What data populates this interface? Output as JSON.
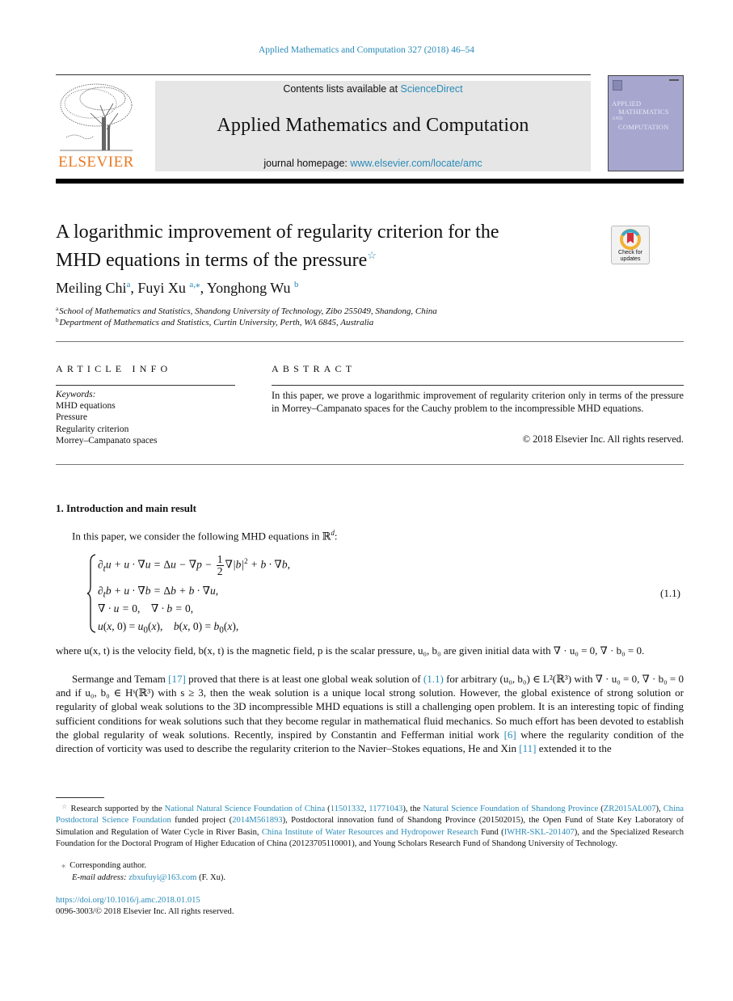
{
  "running_head": "Applied Mathematics and Computation 327 (2018) 46–54",
  "masthead": {
    "publisher_wordmark": "ELSEVIER",
    "contents_prefix": "Contents lists available at ",
    "contents_link": "ScienceDirect",
    "journal_title": "Applied Mathematics and Computation",
    "homepage_prefix": "journal homepage: ",
    "homepage_link": "www.elsevier.com/locate/amc",
    "cover": {
      "line1": "APPLIED",
      "line2": "MATHEMATICS",
      "line3": "AND",
      "line4": "COMPUTATION",
      "color": "#a6a6cf"
    }
  },
  "article": {
    "title_line1": "A logarithmic improvement of regularity criterion for the",
    "title_line2": "MHD equations in terms of the pressure",
    "title_mark": "☆",
    "check_updates": {
      "line1": "Check for",
      "line2": "updates"
    },
    "authors": [
      {
        "name": "Meiling Chi",
        "sup": "a"
      },
      {
        "name": "Fuyi Xu",
        "sup": "a,⁎"
      },
      {
        "name": "Yonghong Wu",
        "sup": "b"
      }
    ],
    "affiliations": [
      {
        "mark": "a",
        "text": "School of Mathematics and Statistics, Shandong University of Technology, Zibo 255049, Shandong, China"
      },
      {
        "mark": "b",
        "text": "Department of Mathematics and Statistics, Curtin University, Perth, WA 6845, Australia"
      }
    ]
  },
  "article_info": {
    "heading": "ARTICLE INFO",
    "keywords_label": "Keywords:",
    "keywords": [
      "MHD equations",
      "Pressure",
      "Regularity criterion",
      "Morrey–Campanato spaces"
    ]
  },
  "abstract": {
    "heading": "ABSTRACT",
    "text": "In this paper, we prove a logarithmic improvement of regularity criterion only in terms of the pressure in Morrey–Campanato spaces for the Cauchy problem to the incompressible MHD equations.",
    "copyright": "© 2018 Elsevier Inc. All rights reserved."
  },
  "section": {
    "heading": "1. Introduction and main result",
    "intro": "In this paper, we consider the following MHD equations in ℝ",
    "intro_sup": "d",
    "intro_end": ":",
    "equation_number": "(1.1)",
    "para_where": "where u(x, t) is the velocity field, b(x, t) is the magnetic field, p is the scalar pressure, u₀, b₀ are given initial data with ∇ · u₀ = 0, ∇ · b₀ = 0.",
    "para2_before_ref1": "Sermange and Temam ",
    "ref1": "[17]",
    "para2_mid1": " proved that there is at least one global weak solution of ",
    "ref_eq": "(1.1)",
    "para2_mid2": " for arbitrary (u₀, b₀) ∈ L²(ℝ³) with ∇ · u₀ = 0, ∇ · b₀ = 0 and if u₀, b₀ ∈ Hˢ(ℝ³) with s ≥ 3, then the weak solution is a unique local strong solution. However, the global existence of strong solution or regularity of global weak solutions to the 3D incompressible MHD equations is still a challenging open problem. It is an interesting topic of finding sufficient conditions for weak solutions such that they become regular in mathematical fluid mechanics. So much effort has been devoted to establish the global regularity of weak solutions. Recently, inspired by Constantin and Fefferman initial work ",
    "ref2": "[6]",
    "para2_mid3": " where the regularity condition of the direction of vorticity was used to describe the regularity criterion to the Navier–Stokes equations, He and Xin ",
    "ref3": "[11]",
    "para2_end": " extended it to the"
  },
  "footnotes": {
    "star_mark": "☆",
    "funding": [
      {
        "t": "Research supported by the "
      },
      {
        "l": "National Natural Science Foundation of China"
      },
      {
        "t": " ("
      },
      {
        "l": "11501332"
      },
      {
        "t": ", "
      },
      {
        "l": "11771043"
      },
      {
        "t": "), the "
      },
      {
        "l": "Natural Science Foundation of Shandong Province"
      },
      {
        "t": " ("
      },
      {
        "l": "ZR2015AL007"
      },
      {
        "t": "), "
      },
      {
        "l": "China Postdoctoral Science Foundation"
      },
      {
        "t": " funded project ("
      },
      {
        "l": "2014M561893"
      },
      {
        "t": "), Postdoctoral innovation fund of Shandong Province (201502015), the Open Fund of State Key Laboratory of Simulation and Regulation of Water Cycle in River Basin, "
      },
      {
        "l": "China Institute of Water Resources and Hydropower Research"
      },
      {
        "t": " Fund ("
      },
      {
        "l": "IWHR-SKL-201407"
      },
      {
        "t": "), and the Specialized Research Foundation for the Doctoral Program of Higher Education of China (20123705110001), and Young Scholars Research Fund of Shandong University of Technology."
      }
    ],
    "corresponding_mark": "⁎",
    "corresponding": "Corresponding author.",
    "email_label": "E-mail address: ",
    "email": "zbxufuyi@163.com",
    "email_suffix": " (F. Xu).",
    "doi": "https://doi.org/10.1016/j.amc.2018.01.015",
    "issn": "0096-3003/© 2018 Elsevier Inc. All rights reserved."
  },
  "colors": {
    "link": "#2a8bb8",
    "elsevier_orange": "#e97a23",
    "banner_bg": "#e6e6e6"
  }
}
